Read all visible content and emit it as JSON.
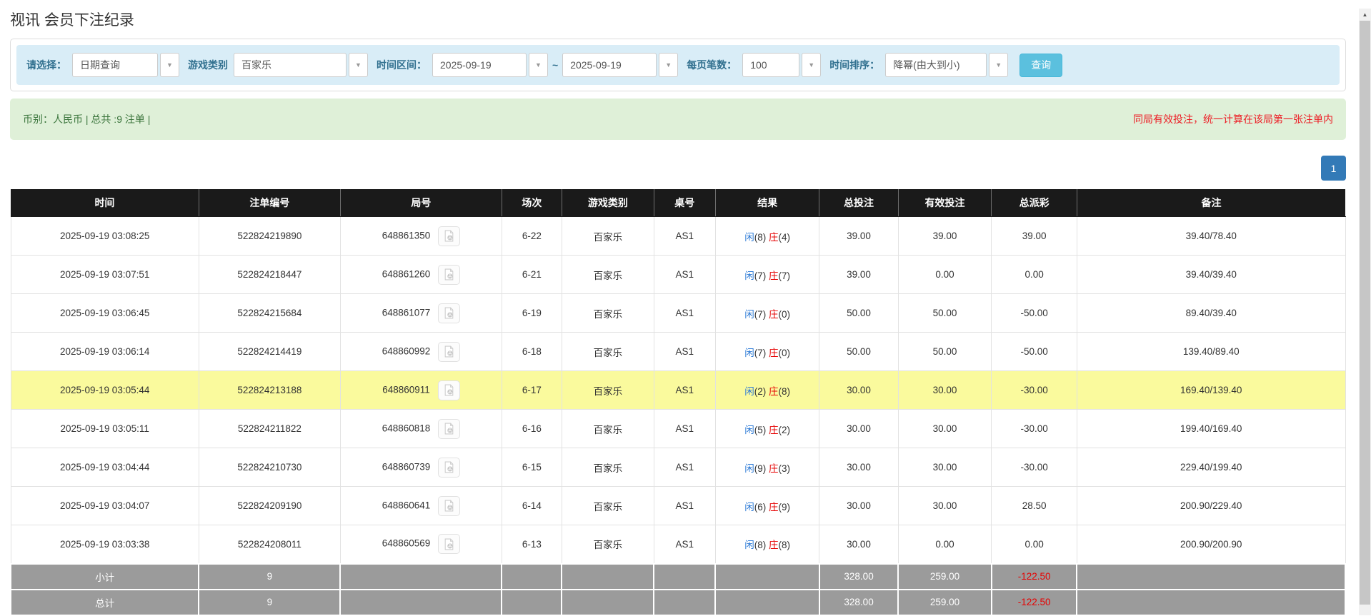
{
  "page": {
    "title": "视讯 会员下注纪录"
  },
  "filters": {
    "select_label": "请选择：",
    "select_value": "日期查询",
    "game_type_label": "游戏类别",
    "game_type_value": "百家乐",
    "time_range_label": "时间区间：",
    "time_from": "2025-09-19",
    "time_separator": "~",
    "time_to": "2025-09-19",
    "page_size_label": "每页笔数：",
    "page_size_value": "100",
    "sort_label": "时间排序：",
    "sort_value": "降幂(由大到小)",
    "search_button": "查询"
  },
  "summary": {
    "left_text": "币别：人民币 | 总共 :9 注单 |",
    "right_text": "同局有效投注，统一计算在该局第一张注单内"
  },
  "pagination": {
    "current_page": "1"
  },
  "colors": {
    "accent_blue": "#2e7bd6",
    "negative_red": "#e60000",
    "highlight_yellow": "#fafa9d",
    "header_black": "#1a1a1a",
    "footer_gray": "#9b9b9b",
    "filter_bg": "#d9edf7",
    "summary_bg": "#dff0d8",
    "search_btn_bg": "#5bc0de",
    "page_btn_bg": "#337ab7"
  },
  "table": {
    "headers": [
      "时间",
      "注单编号",
      "局号",
      "场次",
      "游戏类别",
      "桌号",
      "结果",
      "总投注",
      "有效投注",
      "总派彩",
      "备注"
    ],
    "col_widths": [
      "14.1%",
      "10.6%",
      "12.1%",
      "4.5%",
      "6.9%",
      "4.6%",
      "7.8%",
      "5.9%",
      "7.0%",
      "6.4%",
      "20.1%"
    ],
    "result_labels": {
      "player": "闲",
      "banker": "庄"
    },
    "rows": [
      {
        "time": "2025-09-19 03:08:25",
        "bet_id": "522824219890",
        "round_id": "648861350",
        "session": "6-22",
        "game": "百家乐",
        "table_no": "AS1",
        "result": {
          "player": "8",
          "banker": "4"
        },
        "total_bet": "39.00",
        "valid_bet": "39.00",
        "payout": "39.00",
        "note": "39.40/78.40",
        "highlighted": false
      },
      {
        "time": "2025-09-19 03:07:51",
        "bet_id": "522824218447",
        "round_id": "648861260",
        "session": "6-21",
        "game": "百家乐",
        "table_no": "AS1",
        "result": {
          "player": "7",
          "banker": "7"
        },
        "total_bet": "39.00",
        "valid_bet": "0.00",
        "payout": "0.00",
        "note": "39.40/39.40",
        "highlighted": false
      },
      {
        "time": "2025-09-19 03:06:45",
        "bet_id": "522824215684",
        "round_id": "648861077",
        "session": "6-19",
        "game": "百家乐",
        "table_no": "AS1",
        "result": {
          "player": "7",
          "banker": "0"
        },
        "total_bet": "50.00",
        "valid_bet": "50.00",
        "payout": "-50.00",
        "note": "89.40/39.40",
        "highlighted": false
      },
      {
        "time": "2025-09-19 03:06:14",
        "bet_id": "522824214419",
        "round_id": "648860992",
        "session": "6-18",
        "game": "百家乐",
        "table_no": "AS1",
        "result": {
          "player": "7",
          "banker": "0"
        },
        "total_bet": "50.00",
        "valid_bet": "50.00",
        "payout": "-50.00",
        "note": "139.40/89.40",
        "highlighted": false
      },
      {
        "time": "2025-09-19 03:05:44",
        "bet_id": "522824213188",
        "round_id": "648860911",
        "session": "6-17",
        "game": "百家乐",
        "table_no": "AS1",
        "result": {
          "player": "2",
          "banker": "8"
        },
        "total_bet": "30.00",
        "valid_bet": "30.00",
        "payout": "-30.00",
        "note": "169.40/139.40",
        "highlighted": true
      },
      {
        "time": "2025-09-19 03:05:11",
        "bet_id": "522824211822",
        "round_id": "648860818",
        "session": "6-16",
        "game": "百家乐",
        "table_no": "AS1",
        "result": {
          "player": "5",
          "banker": "2"
        },
        "total_bet": "30.00",
        "valid_bet": "30.00",
        "payout": "-30.00",
        "note": "199.40/169.40",
        "highlighted": false
      },
      {
        "time": "2025-09-19 03:04:44",
        "bet_id": "522824210730",
        "round_id": "648860739",
        "session": "6-15",
        "game": "百家乐",
        "table_no": "AS1",
        "result": {
          "player": "9",
          "banker": "3"
        },
        "total_bet": "30.00",
        "valid_bet": "30.00",
        "payout": "-30.00",
        "note": "229.40/199.40",
        "highlighted": false
      },
      {
        "time": "2025-09-19 03:04:07",
        "bet_id": "522824209190",
        "round_id": "648860641",
        "session": "6-14",
        "game": "百家乐",
        "table_no": "AS1",
        "result": {
          "player": "6",
          "banker": "9"
        },
        "total_bet": "30.00",
        "valid_bet": "30.00",
        "payout": "28.50",
        "note": "200.90/229.40",
        "highlighted": false
      },
      {
        "time": "2025-09-19 03:03:38",
        "bet_id": "522824208011",
        "round_id": "648860569",
        "session": "6-13",
        "game": "百家乐",
        "table_no": "AS1",
        "result": {
          "player": "8",
          "banker": "8"
        },
        "total_bet": "30.00",
        "valid_bet": "0.00",
        "payout": "0.00",
        "note": "200.90/200.90",
        "highlighted": false
      }
    ],
    "footer_rows": [
      {
        "label": "小计",
        "count": "9",
        "total_bet": "328.00",
        "valid_bet": "259.00",
        "payout": "-122.50"
      },
      {
        "label": "总计",
        "count": "9",
        "total_bet": "328.00",
        "valid_bet": "259.00",
        "payout": "-122.50"
      }
    ]
  }
}
